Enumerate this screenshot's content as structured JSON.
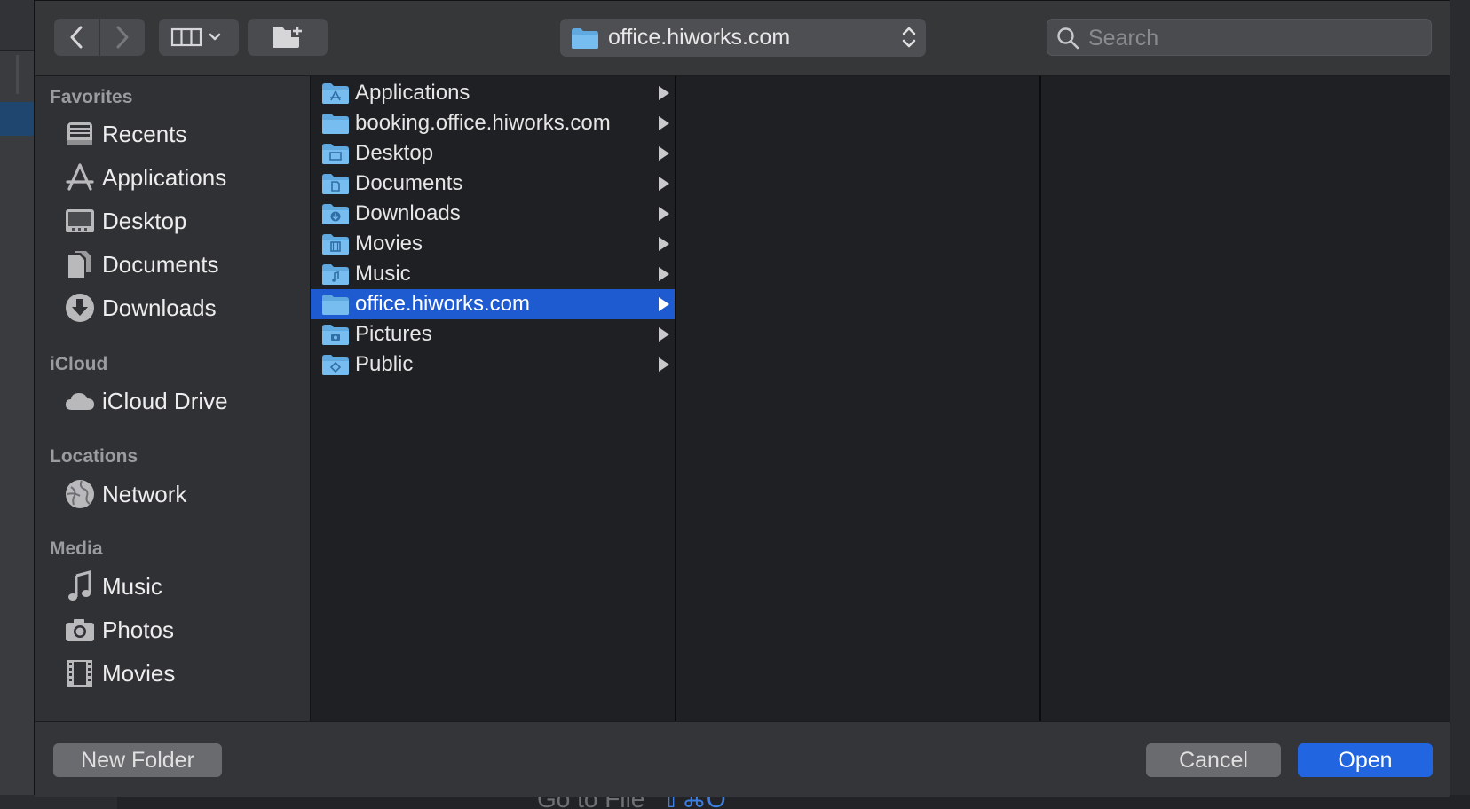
{
  "background": {
    "goto_label": "Go to File",
    "goto_shortcut": "⇧⌘O"
  },
  "toolbar": {
    "back_icon": "chevron-left",
    "forward_icon": "chevron-right",
    "view_icon": "column-view",
    "new_folder_icon": "folder-plus",
    "path_label": "office.hiworks.com",
    "search_placeholder": "Search"
  },
  "sidebar": {
    "sections": [
      {
        "title": "Favorites",
        "items": [
          {
            "label": "Recents",
            "icon": "recents-icon"
          },
          {
            "label": "Applications",
            "icon": "applications-icon"
          },
          {
            "label": "Desktop",
            "icon": "desktop-icon"
          },
          {
            "label": "Documents",
            "icon": "documents-icon"
          },
          {
            "label": "Downloads",
            "icon": "downloads-icon"
          }
        ]
      },
      {
        "title": "iCloud",
        "items": [
          {
            "label": "iCloud Drive",
            "icon": "cloud-icon"
          }
        ]
      },
      {
        "title": "Locations",
        "items": [
          {
            "label": "Network",
            "icon": "globe-icon"
          }
        ]
      },
      {
        "title": "Media",
        "items": [
          {
            "label": "Music",
            "icon": "music-note-icon"
          },
          {
            "label": "Photos",
            "icon": "camera-icon"
          },
          {
            "label": "Movies",
            "icon": "film-icon"
          }
        ]
      }
    ]
  },
  "column1": {
    "items": [
      {
        "label": "Applications",
        "icon": "applications"
      },
      {
        "label": "booking.office.hiworks.com",
        "icon": "plain"
      },
      {
        "label": "Desktop",
        "icon": "desktop"
      },
      {
        "label": "Documents",
        "icon": "documents"
      },
      {
        "label": "Downloads",
        "icon": "downloads"
      },
      {
        "label": "Movies",
        "icon": "movies"
      },
      {
        "label": "Music",
        "icon": "music"
      },
      {
        "label": "office.hiworks.com",
        "icon": "plain",
        "selected": true
      },
      {
        "label": "Pictures",
        "icon": "pictures"
      },
      {
        "label": "Public",
        "icon": "public"
      }
    ]
  },
  "footer": {
    "new_folder_label": "New Folder",
    "cancel_label": "Cancel",
    "open_label": "Open"
  },
  "colors": {
    "accent": "#2166e0",
    "selection": "#1f5bd0",
    "folder": "#6db3e8"
  }
}
